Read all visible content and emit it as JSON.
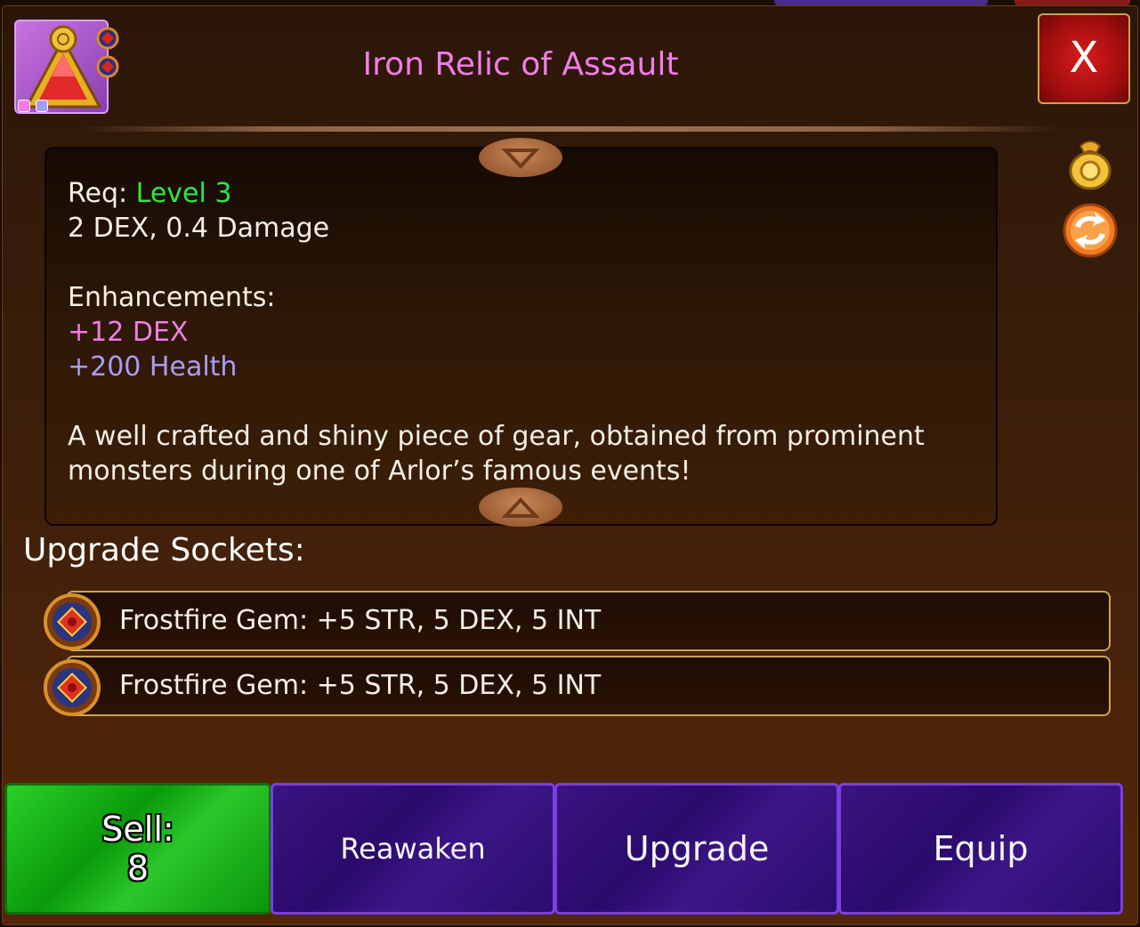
{
  "item": {
    "title": "Iron Relic of Assault",
    "close_label": "X"
  },
  "description": {
    "req_label": "Req:",
    "req_level": "Level 3",
    "base_stats": "2 DEX, 0.4 Damage",
    "enhancements_label": "Enhancements:",
    "enhancement_dex": "+12 DEX",
    "enhancement_health": "+200 Health",
    "flavor_line1": "A well crafted and shiny piece of gear, obtained from prominent",
    "flavor_line2": "monsters during one of Arlor’s famous events!"
  },
  "sockets": {
    "title": "Upgrade Sockets:",
    "items": [
      {
        "text": "Frostfire Gem: +5 STR, 5 DEX, 5 INT"
      },
      {
        "text": "Frostfire Gem: +5 STR, 5 DEX, 5 INT"
      }
    ]
  },
  "actions": {
    "sell_label": "Sell:",
    "sell_value": "8",
    "reawaken_label": "Reawaken",
    "upgrade_label": "Upgrade",
    "equip_label": "Equip"
  },
  "icons": {
    "item_icon": "red-triangle-relic-icon",
    "sell_icon": "gold-coin-bag-icon",
    "swap_icon": "swap-arrows-icon",
    "gem_icon": "frostfire-gem-icon"
  },
  "colors": {
    "title": "#f07ce8",
    "level": "#2fe93a",
    "dex_enhancement": "#f07ce8",
    "health_enhancement": "#a99cf5",
    "sell_button": "#10a810",
    "action_button": "#2e0c74",
    "close_button": "#b01010"
  }
}
